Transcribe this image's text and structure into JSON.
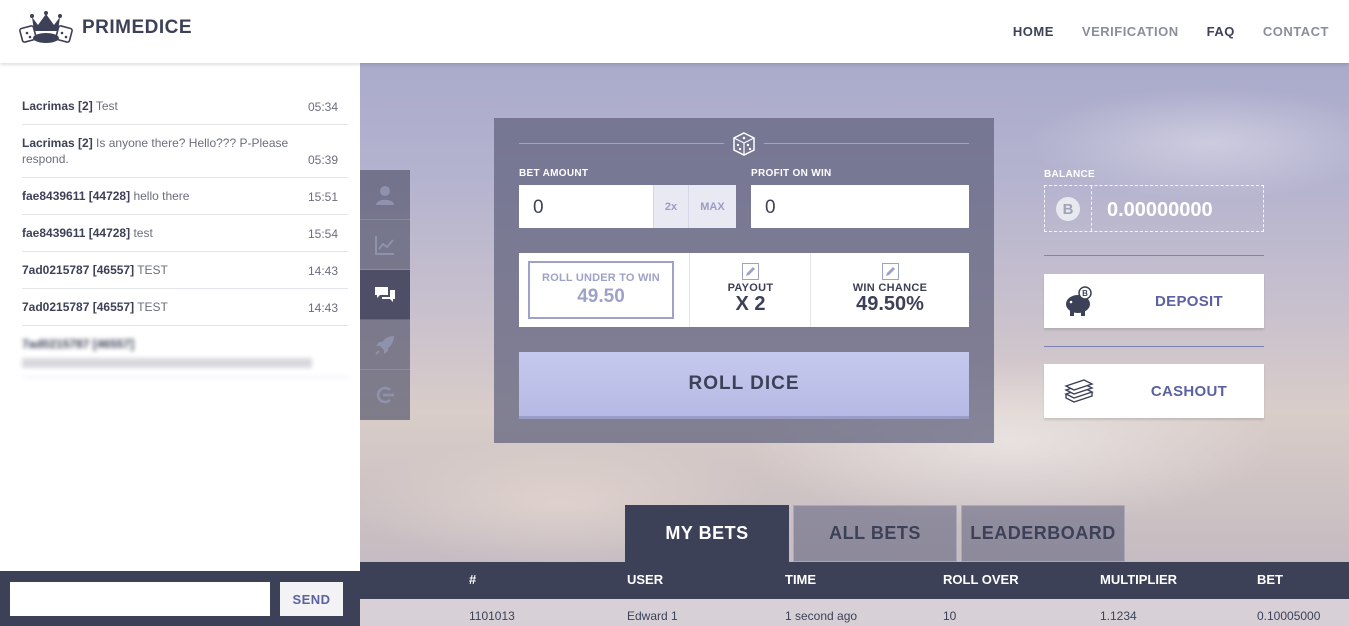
{
  "header": {
    "brand": "PRIMEDICE",
    "nav": [
      {
        "label": "HOME",
        "active": true
      },
      {
        "label": "VERIFICATION",
        "active": false
      },
      {
        "label": "FAQ",
        "active": true
      },
      {
        "label": "CONTACT",
        "active": false
      }
    ]
  },
  "chat": {
    "messages": [
      {
        "user": "Lacrimas [2]",
        "text": "Test",
        "time": "05:34"
      },
      {
        "user": "Lacrimas [2]",
        "text": "Is anyone there? Hello??? P-Please respond.",
        "time": "05:39"
      },
      {
        "user": "fae8439611 [44728]",
        "text": "hello there",
        "time": "15:51"
      },
      {
        "user": "fae8439611 [44728]",
        "text": "test",
        "time": "15:54"
      },
      {
        "user": "7ad0215787 [46557]",
        "text": "TEST",
        "time": "14:43"
      },
      {
        "user": "7ad0215787 [46557]",
        "text": "TEST",
        "time": "14:43"
      },
      {
        "user": "7ad0215787 [46557]",
        "text": "",
        "time": ""
      }
    ],
    "send_label": "SEND",
    "input_value": ""
  },
  "side_icons": [
    "user-icon",
    "chart-icon",
    "chat-icon",
    "rocket-icon",
    "logout-icon"
  ],
  "bet": {
    "bet_amount_label": "BET AMOUNT",
    "bet_amount_value": "0",
    "double_label": "2x",
    "max_label": "MAX",
    "profit_label": "PROFIT ON WIN",
    "profit_value": "0",
    "roll_under_label": "ROLL UNDER TO WIN",
    "roll_under_value": "49.50",
    "payout_label": "PAYOUT",
    "payout_value": "X 2",
    "win_chance_label": "WIN CHANCE",
    "win_chance_value": "49.50%",
    "roll_label": "ROLL DICE"
  },
  "wallet": {
    "balance_label": "BALANCE",
    "balance_value": "0.00000000",
    "deposit_label": "DEPOSIT",
    "cashout_label": "CASHOUT"
  },
  "tabs": [
    {
      "label": "MY BETS",
      "active": true
    },
    {
      "label": "ALL BETS",
      "active": false
    },
    {
      "label": "LEADERBOARD",
      "active": false
    }
  ],
  "table": {
    "columns": [
      "#",
      "USER",
      "TIME",
      "ROLL OVER",
      "MULTIPLIER",
      "BET"
    ],
    "rows": [
      [
        "1101013",
        "Edward 1",
        "1 second ago",
        "10",
        "1.1234",
        "0.10005000"
      ]
    ]
  },
  "colors": {
    "primary": "#3d4157",
    "accent": "#5c61a0",
    "roll_button": "#c0c3eb"
  }
}
